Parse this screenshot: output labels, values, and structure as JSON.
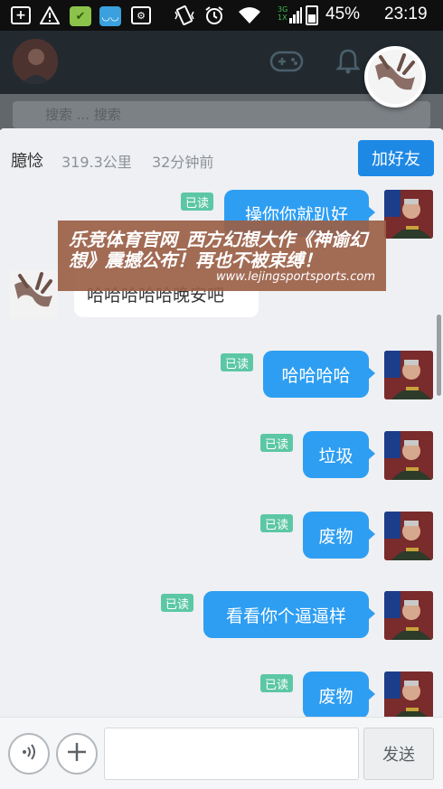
{
  "status_bar": {
    "battery": "45%",
    "time": "23:19",
    "network_top": "3G",
    "network_bottom": "1X",
    "icons": [
      "plus-box-icon",
      "warning-icon",
      "shopping-bag-icon",
      "app-icon",
      "settings-icon",
      "vibrate-icon",
      "alarm-icon",
      "wifi-icon",
      "signal-icon",
      "battery-icon"
    ]
  },
  "background": {
    "search_placeholder": "搜索 ... 搜索",
    "icons": [
      "gamepad-icon",
      "bell-icon"
    ]
  },
  "chat": {
    "contact_name": "臆惗",
    "distance": "319.3公里",
    "last_active": "32分钟前",
    "add_friend_label": "加好友",
    "read_label": "已读",
    "messages": [
      {
        "direction": "out",
        "text": "操你你就趴好",
        "read": true
      },
      {
        "direction": "in",
        "text": "哈哈哈哈哈晚安吧"
      },
      {
        "direction": "out",
        "text": "哈哈哈哈",
        "read": true
      },
      {
        "direction": "out",
        "text": "垃圾",
        "read": true
      },
      {
        "direction": "out",
        "text": "废物",
        "read": true
      },
      {
        "direction": "out",
        "text": "看看你个逼逼样",
        "read": true
      },
      {
        "direction": "out",
        "text": "废物",
        "read": true
      }
    ]
  },
  "watermark": {
    "title": "乐竞体育官网_西方幻想大作《神谕幻想》震撼公布！再也不被束缚！",
    "url": "www.lejingsportsports.com"
  },
  "input_bar": {
    "send_label": "发送",
    "icons": [
      "voice-icon",
      "plus-icon"
    ]
  },
  "colors": {
    "accent": "#1e88e5",
    "bubble_out": "#2e9ef2",
    "read_badge": "#5cc7a4"
  }
}
